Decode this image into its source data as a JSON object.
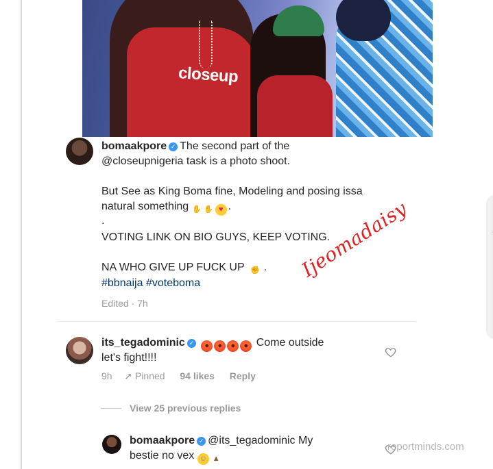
{
  "post": {
    "photo_brand": "closeup",
    "author": "bomaakpore",
    "caption_line1": "The second part of the",
    "caption_line2": "@closeupnigeria task is a photo shoot.",
    "caption_line3": "But See as King Boma fine, Modeling and posing issa",
    "caption_line4": "natural something",
    "caption_line5": ".",
    "caption_line6": "VOTING LINK ON BIO GUYS, KEEP VOTING.",
    "caption_line7": "NA WHO GIVE UP FUCK UP",
    "caption_line7_end": ".",
    "hashtags": "#bbnaija #voteboma",
    "edited": "Edited · 7h"
  },
  "watermark": "Ijeomadaisy",
  "comment": {
    "author": "its_tegadominic",
    "text_line1": "Come outside",
    "text_line2": "let's fight!!!!",
    "time": "9h",
    "pinned": "Pinned",
    "likes": "94 likes",
    "reply": "Reply"
  },
  "view_replies": "View 25 previous replies",
  "reply": {
    "author": "bomaakpore",
    "mention": "@its_tegadominic",
    "text_line1": "My",
    "text_line2": "bestie no vex"
  },
  "site_watermark": "reportminds.com",
  "colors": {
    "verified": "#3897f0",
    "text": "#262626",
    "meta": "#999999",
    "watermark": "#e02020"
  },
  "icons": [
    "verified-badge-icon",
    "pin-icon",
    "heart-icon",
    "chevron-left-icon"
  ]
}
